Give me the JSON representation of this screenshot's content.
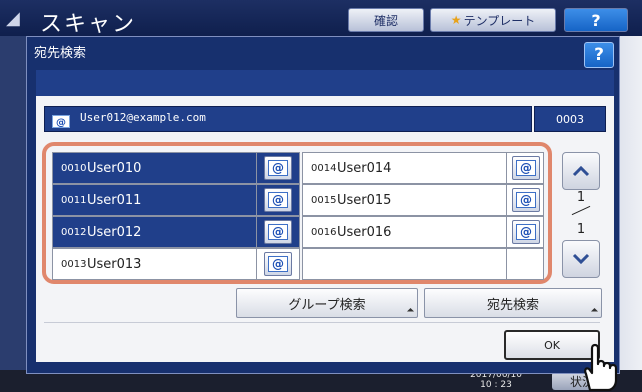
{
  "background_app": {
    "title": "スキャン",
    "confirm_label": "確認",
    "template_label": "テンプレート",
    "help_label": "?",
    "clock": "2017/06/10\n10 : 23",
    "status_label": "状況"
  },
  "dialog": {
    "title": "宛先検索",
    "help_label": "?",
    "address": "User012@example.com",
    "count": "0003",
    "entries": [
      {
        "num": "0010",
        "name": "User010",
        "selected": true
      },
      {
        "num": "0011",
        "name": "User011",
        "selected": true
      },
      {
        "num": "0012",
        "name": "User012",
        "selected": true
      },
      {
        "num": "0013",
        "name": "User013",
        "selected": false
      },
      {
        "num": "0014",
        "name": "User014",
        "selected": false
      },
      {
        "num": "0015",
        "name": "User015",
        "selected": false
      },
      {
        "num": "0016",
        "name": "User016",
        "selected": false
      }
    ],
    "email_icon_glyph": "@",
    "page": {
      "current": "1",
      "total": "1"
    },
    "group_search_label": "グループ検索",
    "address_search_label": "宛先検索",
    "ok_label": "OK"
  },
  "colors": {
    "selected_row": "#203f8a",
    "highlight_frame": "#e0876c",
    "dialog_bg": "#17306e"
  },
  "icons": [
    "back-arrow-icon",
    "star-icon",
    "email-icon",
    "chevron-up-icon",
    "chevron-down-icon",
    "pointing-hand-icon"
  ]
}
